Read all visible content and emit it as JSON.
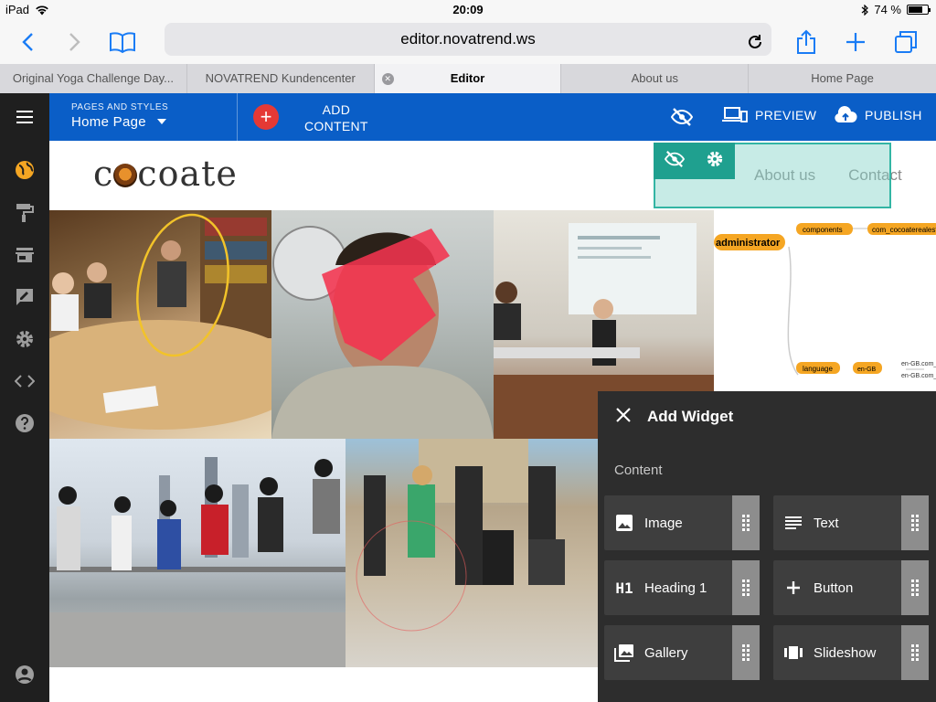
{
  "status": {
    "device": "iPad",
    "time": "20:09",
    "battery": "74 %",
    "battery_level": 0.74
  },
  "browser": {
    "url": "editor.novatrend.ws",
    "tabs": [
      {
        "label": "Original Yoga Challenge Day..."
      },
      {
        "label": "NOVATREND Kundencenter"
      },
      {
        "label": "Editor"
      },
      {
        "label": "About us"
      },
      {
        "label": "Home Page"
      }
    ]
  },
  "appbar": {
    "pages_label": "PAGES AND STYLES",
    "current_page": "Home Page",
    "add_content_line1": "ADD",
    "add_content_line2": "CONTENT",
    "preview_label": "PREVIEW",
    "publish_label": "PUBLISH"
  },
  "site": {
    "logo": "cocoate",
    "nav": [
      "About us",
      "Contact"
    ],
    "diagram": {
      "root": "administrator",
      "nodes": [
        "components",
        "com_cocoaterealestate",
        "language",
        "en-GB",
        "en-GB.com_",
        "en-GB.com_"
      ]
    }
  },
  "widget_panel": {
    "title": "Add Widget",
    "section": "Content",
    "widgets": [
      {
        "label": "Image",
        "icon": "image-icon"
      },
      {
        "label": "Text",
        "icon": "text-icon"
      },
      {
        "label": "Heading 1",
        "icon": "heading-icon"
      },
      {
        "label": "Button",
        "icon": "plus-icon"
      },
      {
        "label": "Gallery",
        "icon": "gallery-icon"
      },
      {
        "label": "Slideshow",
        "icon": "slideshow-icon"
      }
    ]
  },
  "colors": {
    "accent": "#0a5ec7",
    "add": "#e53935",
    "selection": "#1fa08f",
    "sidebar": "#1f1f1f",
    "panel": "#2d2d2d"
  }
}
